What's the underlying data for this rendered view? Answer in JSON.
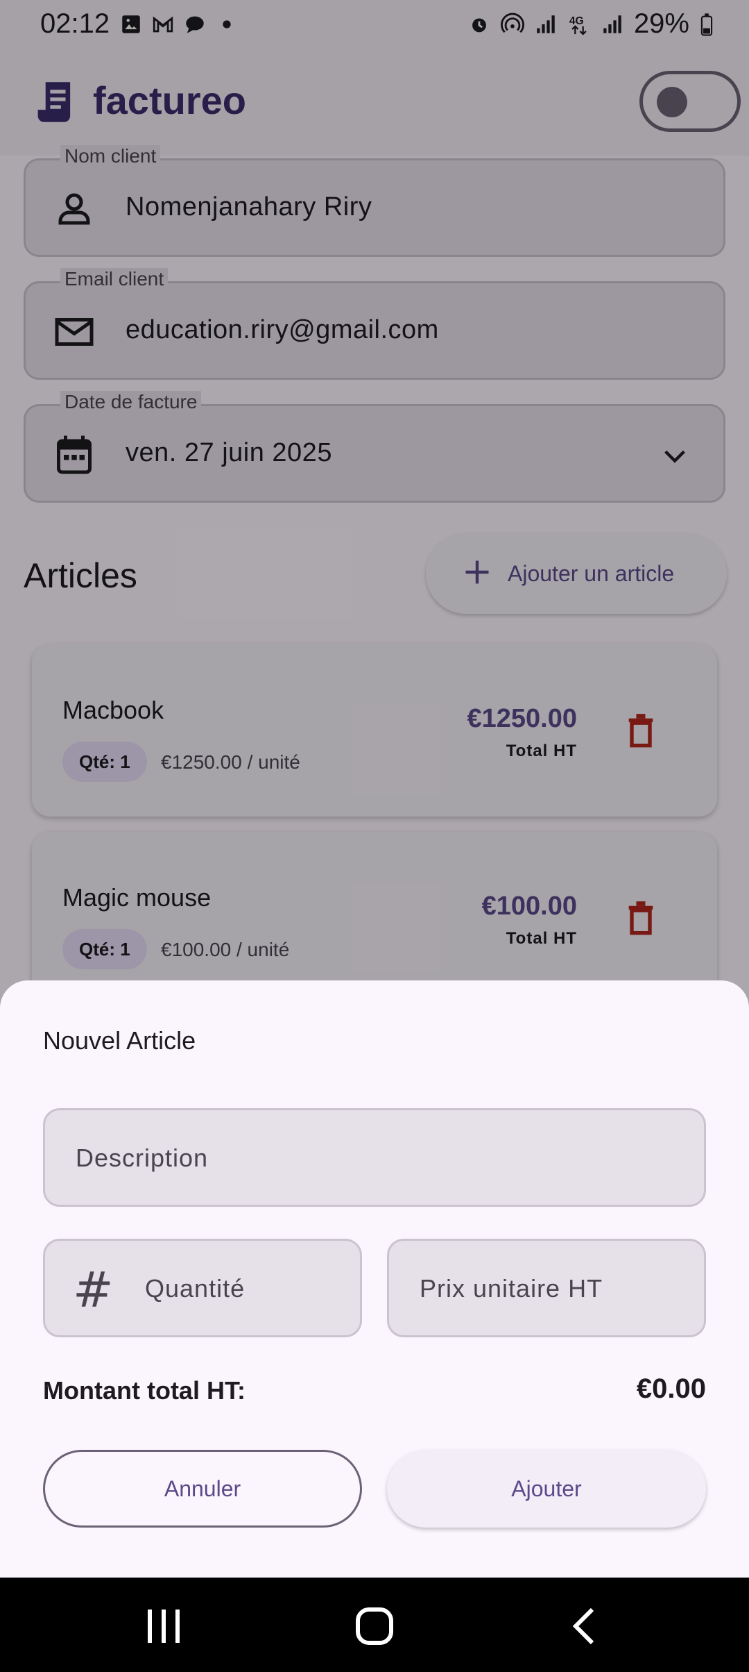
{
  "status_bar": {
    "time": "02:12",
    "left_icons": [
      "image-icon",
      "gmail-icon",
      "chat-icon",
      "dot-icon"
    ],
    "right_icons": [
      "alarm-icon",
      "hotspot-icon",
      "signal-icon",
      "4g-icon",
      "signal-icon-2"
    ],
    "battery": "29%"
  },
  "app_bar": {
    "title": "factureo",
    "logo_icon": "receipt-icon",
    "theme_toggle_on": false
  },
  "form": {
    "client_name": {
      "label": "Nom client",
      "value": "Nomenjanahary Riry",
      "icon": "person-icon"
    },
    "client_email": {
      "label": "Email client",
      "value": "education.riry@gmail.com",
      "icon": "mail-icon"
    },
    "invoice_date": {
      "label": "Date de facture",
      "value": "ven. 27 juin 2025",
      "icon": "calendar-icon"
    }
  },
  "articles": {
    "title": "Articles",
    "add_button": "Ajouter un article",
    "items": [
      {
        "name": "Macbook",
        "qty": "Qté: 1",
        "unit_price": "€1250.00 / unité",
        "total": "€1250.00",
        "total_label": "Total HT"
      },
      {
        "name": "Magic mouse",
        "qty": "Qté: 1",
        "unit_price": "€100.00 / unité",
        "total": "€100.00",
        "total_label": "Total HT"
      }
    ]
  },
  "sheet": {
    "title": "Nouvel Article",
    "description_placeholder": "Description",
    "quantity_placeholder": "Quantité",
    "quantity_icon_glyph": "#",
    "price_placeholder": "Prix unitaire HT",
    "total_label": "Montant total HT:",
    "total_value": "€0.00",
    "cancel_button": "Annuler",
    "add_button": "Ajouter"
  },
  "colors": {
    "accent": "#5b4a8b",
    "danger": "#b3261e",
    "sheet_bg": "#fbf5fd"
  }
}
